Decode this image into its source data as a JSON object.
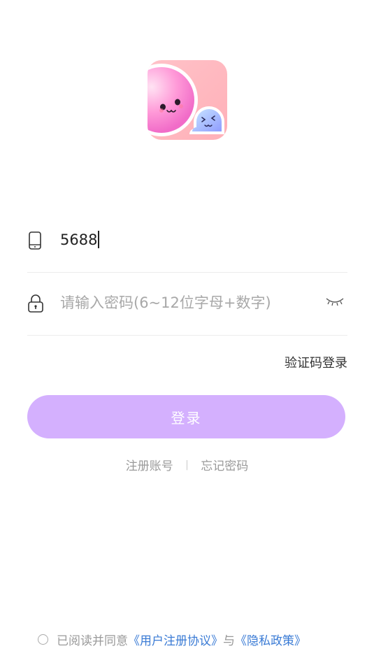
{
  "app_logo": {
    "icon": "ghost-mascot-logo-icon"
  },
  "phone": {
    "value": "5688",
    "icon": "phone-icon"
  },
  "password": {
    "placeholder": "请输入密码(6~12位字母+数字)",
    "icon": "lock-icon",
    "toggle_icon": "eye-closed-icon"
  },
  "code_login_label": "验证码登录",
  "login_label": "登录",
  "links": {
    "register": "注册账号",
    "separator": "|",
    "forgot": "忘记密码"
  },
  "agreement": {
    "prefix": "已阅读并同意",
    "user_agreement": "《用户注册协议》",
    "conjunction": "与",
    "privacy_policy": "《隐私政策》"
  },
  "colors": {
    "accent": "#d4b0fe",
    "link": "#3a7bd5",
    "logo_bg": "#ffb8c0"
  }
}
